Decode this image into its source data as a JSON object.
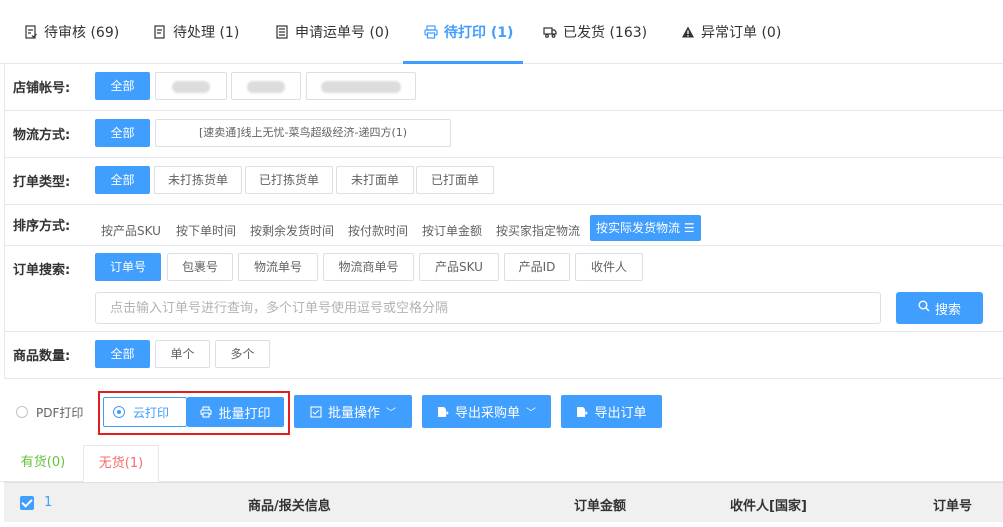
{
  "tabs": [
    {
      "label": "待审核 (69)",
      "icon": "document-check-icon"
    },
    {
      "label": "待处理 (1)",
      "icon": "document-edit-icon"
    },
    {
      "label": "申请运单号 (0)",
      "icon": "document-list-icon"
    },
    {
      "label": "待打印 (1)",
      "icon": "printer-icon"
    },
    {
      "label": "已发货 (163)",
      "icon": "truck-icon"
    },
    {
      "label": "异常订单 (0)",
      "icon": "warning-icon"
    }
  ],
  "filters": {
    "store": {
      "label": "店铺帐号:",
      "all": "全部"
    },
    "logistics": {
      "label": "物流方式:",
      "all": "全部",
      "option": "[速卖通]线上无忧-菜鸟超级经济-递四方(1)"
    },
    "print_type": {
      "label": "打单类型:",
      "options": [
        "全部",
        "未打拣货单",
        "已打拣货单",
        "未打面单",
        "已打面单"
      ]
    },
    "sort": {
      "label": "排序方式:",
      "options": [
        "按产品SKU",
        "按下单时间",
        "按剩余发货时间",
        "按付款时间",
        "按订单金额",
        "按买家指定物流"
      ],
      "active": "按实际发货物流"
    },
    "search": {
      "label": "订单搜索:",
      "options": [
        "订单号",
        "包裹号",
        "物流单号",
        "物流商单号",
        "产品SKU",
        "产品ID",
        "收件人"
      ],
      "placeholder": "点击输入订单号进行查询，多个订单号使用逗号或空格分隔",
      "button": "搜索"
    },
    "quantity": {
      "label": "商品数量:",
      "options": [
        "全部",
        "单个",
        "多个"
      ]
    }
  },
  "toolbar": {
    "pdf_print": "PDF打印",
    "cloud_print": "云打印",
    "batch_print": "批量打印",
    "batch_ops": "批量操作",
    "export_purchase": "导出采购单",
    "export_orders": "导出订单"
  },
  "subtabs": {
    "in_stock": "有货(0)",
    "out_of_stock": "无货(1)"
  },
  "table": {
    "selected_count": "1",
    "columns": [
      "商品/报关信息",
      "订单金额",
      "收件人[国家]",
      "订单号"
    ]
  },
  "colors": {
    "primary": "#409eff",
    "highlight_frame": "#e02020"
  }
}
